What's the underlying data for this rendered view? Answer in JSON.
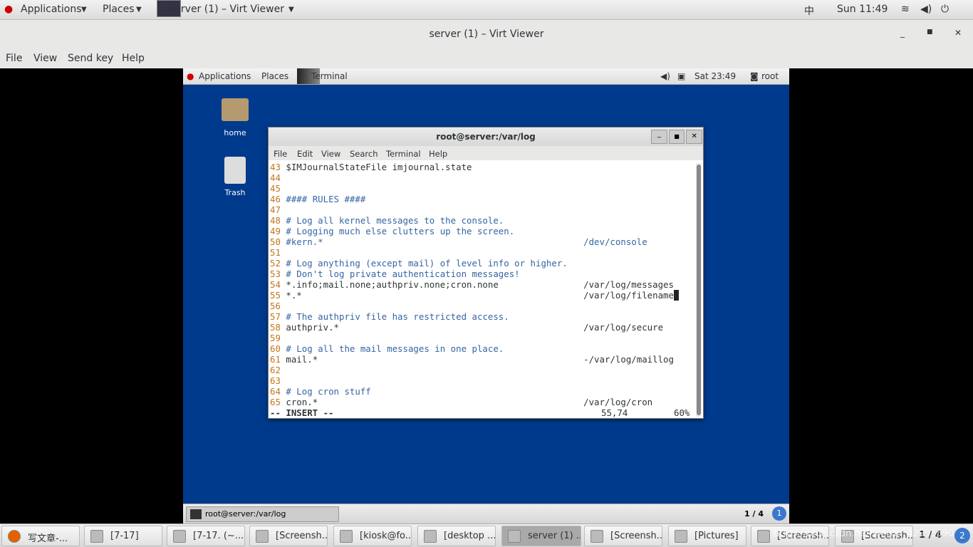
{
  "host_topbar": {
    "applications": "Applications",
    "places": "Places",
    "window": "server (1) – Virt Viewer",
    "input_method": "中",
    "clock": "Sun 11:49"
  },
  "window": {
    "title": "server (1) – Virt Viewer",
    "menu": [
      "File",
      "View",
      "Send key",
      "Help"
    ]
  },
  "guest_topbar": {
    "applications": "Applications",
    "places": "Places",
    "window": "Terminal",
    "clock": "Sat 23:49",
    "user": "root"
  },
  "desktop_icons": [
    {
      "label": "home",
      "icon": "folder-icon"
    },
    {
      "label": "Trash",
      "icon": "trash-icon"
    }
  ],
  "terminal": {
    "title": "root@server:/var/log",
    "menu": [
      "File",
      "Edit",
      "View",
      "Search",
      "Terminal",
      "Help"
    ],
    "lines": [
      {
        "n": "43",
        "t": "$IMJournalStateFile imjournal.state",
        "c": false
      },
      {
        "n": "44",
        "t": "",
        "c": false
      },
      {
        "n": "45",
        "t": "",
        "c": false
      },
      {
        "n": "46",
        "t": "#### RULES ####",
        "c": true
      },
      {
        "n": "47",
        "t": "",
        "c": false
      },
      {
        "n": "48",
        "t": "# Log all kernel messages to the console.",
        "c": true
      },
      {
        "n": "49",
        "t": "# Logging much else clutters up the screen.",
        "c": true
      },
      {
        "n": "50",
        "t": "#kern.*                                                 /dev/console",
        "c": true
      },
      {
        "n": "51",
        "t": "",
        "c": false
      },
      {
        "n": "52",
        "t": "# Log anything (except mail) of level info or higher.",
        "c": true
      },
      {
        "n": "53",
        "t": "# Don't log private authentication messages!",
        "c": true
      },
      {
        "n": "54",
        "t": "*.info;mail.none;authpriv.none;cron.none                /var/log/messages",
        "c": false
      },
      {
        "n": "55",
        "t": "*.*                                                     /var/log/filename",
        "c": false,
        "cursor": true
      },
      {
        "n": "56",
        "t": "",
        "c": false
      },
      {
        "n": "57",
        "t": "# The authpriv file has restricted access.",
        "c": true
      },
      {
        "n": "58",
        "t": "authpriv.*                                              /var/log/secure",
        "c": false
      },
      {
        "n": "59",
        "t": "",
        "c": false
      },
      {
        "n": "60",
        "t": "# Log all the mail messages in one place.",
        "c": true
      },
      {
        "n": "61",
        "t": "mail.*                                                  -/var/log/maillog",
        "c": false
      },
      {
        "n": "62",
        "t": "",
        "c": false
      },
      {
        "n": "63",
        "t": "",
        "c": false
      },
      {
        "n": "64",
        "t": "# Log cron stuff",
        "c": true
      },
      {
        "n": "65",
        "t": "cron.*                                                  /var/log/cron",
        "c": false
      }
    ],
    "mode": "-- INSERT --",
    "position": "55,74",
    "percent": "60%"
  },
  "guest_taskbar": {
    "item": "root@server:/var/log",
    "workspace": "1 / 4"
  },
  "host_taskbar": {
    "items": [
      "写文章-...",
      "[7-17]",
      "[7-17. (~...",
      "[Screensh...",
      "[kiosk@fo...",
      "[desktop ...",
      "server (1) ...",
      "[Screensh...",
      "[Pictures]",
      "[Screensh...",
      "[Screensh..."
    ],
    "active": 6,
    "workspace": "1 / 4",
    "watermark": "https://blog.csdn.net/weixin_42995590"
  }
}
